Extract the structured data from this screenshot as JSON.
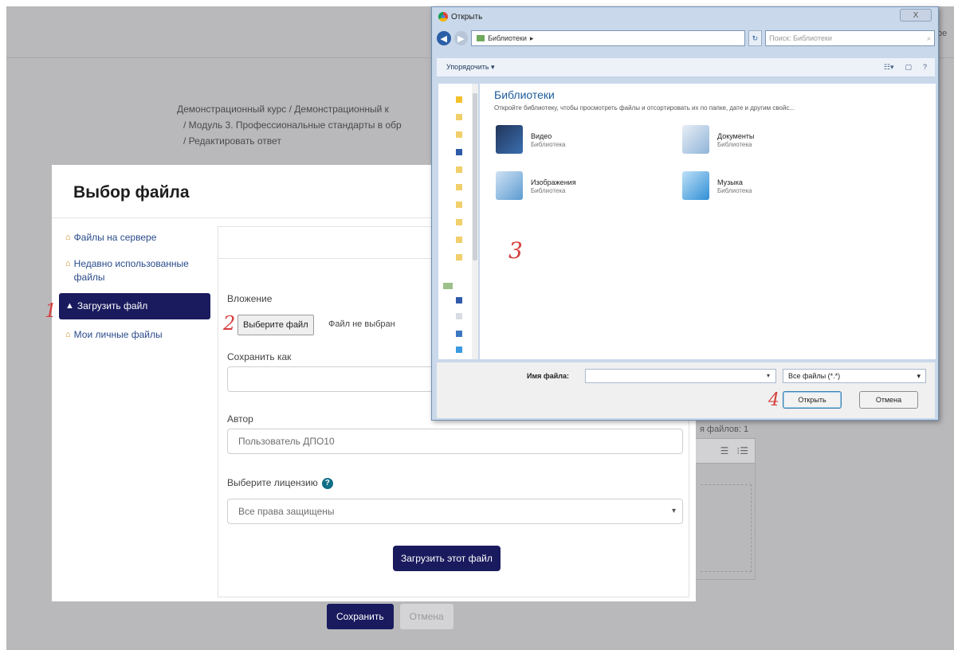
{
  "background": {
    "breadcrumb": [
      "Демонстрационный курс / Демонстрационный к",
      "/ Модуль 3. Профессиональные стандарты в обр",
      "/ Редактировать ответ"
    ],
    "edge_text": "ое",
    "save_label": "Сохранить",
    "cancel_label": "Отмена",
    "files_count": "я файлов: 1"
  },
  "picker": {
    "title": "Выбор файла",
    "sidebar": {
      "items": [
        {
          "label": "Файлы на сервере"
        },
        {
          "label": "Недавно использованные файлы"
        },
        {
          "label": "Загрузить файл"
        },
        {
          "label": "Мои личные файлы"
        }
      ]
    },
    "attachment_label": "Вложение",
    "choose_file_label": "Выберите файл",
    "no_file_label": "Файл не выбран",
    "save_as_label": "Сохранить как",
    "save_as_value": "",
    "author_label": "Автор",
    "author_value": "Пользователь ДПО10",
    "license_label": "Выберите лицензию",
    "license_value": "Все права защищены",
    "upload_label": "Загрузить этот файл"
  },
  "dialog": {
    "title": "Открыть",
    "close_label": "X",
    "address": "Библиотеки",
    "search_placeholder": "Поиск: Библиотеки",
    "organize_label": "Упорядочить ▾",
    "heading": "Библиотеки",
    "description": "Откройте библиотеку, чтобы просмотреть файлы и отсортировать их по папке, дате и другим свойс...",
    "libraries": [
      {
        "name": "Видео",
        "type": "Библиотека",
        "icon": "video-library-icon",
        "color": "#3a6fb0"
      },
      {
        "name": "Документы",
        "type": "Библиотека",
        "icon": "documents-library-icon",
        "color": "#8fb4d8"
      },
      {
        "name": "Изображения",
        "type": "Библиотека",
        "icon": "pictures-library-icon",
        "color": "#5d9bd1"
      },
      {
        "name": "Музыка",
        "type": "Библиотека",
        "icon": "music-library-icon",
        "color": "#2f8fd6"
      }
    ],
    "filename_label": "Имя файла:",
    "filetype_value": "Все файлы (*.*)",
    "open_label": "Открыть",
    "cancel_label": "Отмена"
  },
  "annotations": {
    "step1": "1",
    "step2": "2",
    "step3": "3",
    "step4": "4"
  },
  "colors": {
    "accent": "#1a1b5e",
    "backdrop": "#b9b9bb",
    "annotation": "#d63f3f",
    "dialog_frame": "#c9d8ea",
    "link": "#1e5c9a"
  }
}
